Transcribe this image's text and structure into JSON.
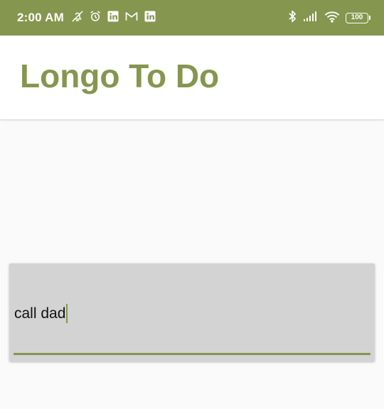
{
  "status_bar": {
    "time": "2:00 AM",
    "background": "#85964f",
    "notification_icons": [
      "notifications-off-icon",
      "alarm-icon",
      "linkedin-icon",
      "gmail-icon",
      "linkedin-icon"
    ],
    "system_icons": [
      "bluetooth-icon",
      "cell-signal-icon",
      "wifi-icon"
    ],
    "battery": "100"
  },
  "app_bar": {
    "title": "Longo To Do",
    "accent": "#85964f"
  },
  "input": {
    "value": "call dad",
    "underline_color": "#85964f",
    "background": "#d3d3d3"
  }
}
